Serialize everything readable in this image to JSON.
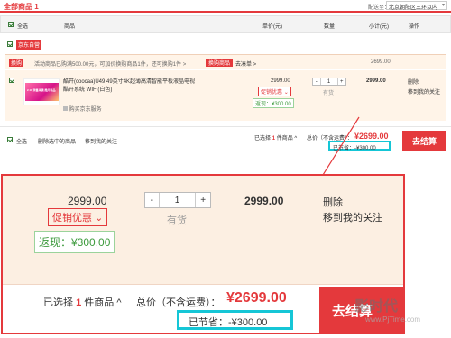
{
  "top": {
    "tab": "全部商品",
    "tab_count": "1",
    "ship_label": "配送至：",
    "ship_addr": "北京朝阳区三环以内"
  },
  "header": {
    "select_all": "全选",
    "product": "商品",
    "unit_price": "单价(元)",
    "qty": "数量",
    "subtotal": "小计(元)",
    "op": "操作"
  },
  "shop": {
    "name": "京东自营"
  },
  "promo": {
    "tag": "换购",
    "text": "活动商品已购满500.00元，可加价换购商品1件，还可换购1件 >",
    "btn": "换购商品",
    "link": "去凑单 >",
    "subtotal": "2699.00"
  },
  "item": {
    "name": "酷开(coocaa)U49 49英寸4K超薄高清智能平板液晶电视 酷开系统 WIFI(白色)",
    "thumb_text": "2.18 预售来袭 酷开新品",
    "service": "购买京东服务",
    "price": "2999.00",
    "promo": "促销优惠",
    "rebate": "返现：¥300.00",
    "qty": "1",
    "minus": "-",
    "plus": "+",
    "stock": "有货",
    "subtotal": "2999.00",
    "delete": "删除",
    "move": "移到我的关注"
  },
  "footer": {
    "select_all": "全选",
    "delete_selected": "删除选中的商品",
    "move_follow": "移到我的关注",
    "selected_prefix": "已选择",
    "selected_count": "1",
    "selected_suffix": "件商品",
    "total_label": "总价（不含运费）：",
    "total": "¥2699.00",
    "saved": "已节省：-¥300.00",
    "checkout": "去结算"
  },
  "zoom": {
    "price": "2999.00",
    "promo": "促销优惠",
    "rebate": "返现：¥300.00",
    "minus": "-",
    "qty": "1",
    "plus": "+",
    "stock": "有货",
    "subtotal": "2999.00",
    "delete": "删除",
    "move": "移到我的关注",
    "selected_prefix": "已选择",
    "selected_count": "1",
    "selected_suffix": "件商品",
    "total_label": "总价（不含运费）：",
    "total": "¥2699.00",
    "saved": "已节省：-¥300.00",
    "checkout": "去结算"
  },
  "watermark": {
    "text": "影时代",
    "url": "www.PjTime.com"
  },
  "colors": {
    "accent": "#e4393c",
    "highlight": "#15c6d6",
    "rebate": "#3c9a3c",
    "bg_item": "#fff4e8",
    "bg_zoom": "#fcefe2"
  }
}
